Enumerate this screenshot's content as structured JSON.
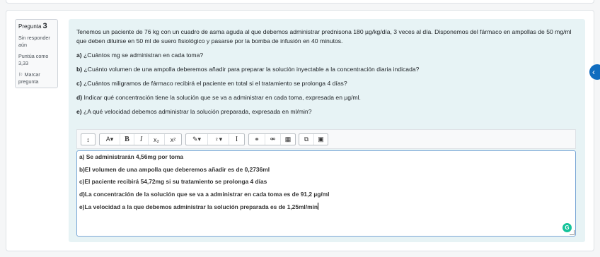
{
  "question": {
    "label": "Pregunta",
    "number": "3",
    "status": "Sin responder aún",
    "score": "Puntúa como 3,33",
    "flag_label": "Marcar pregunta",
    "intro": "Tenemos un paciente de 76 kg con un cuadro de asma aguda al que debemos administrar prednisona 180 µg/kg/día, 3 veces al día. Disponemos del fármaco en ampollas de 50 mg/ml que deben diluirse en 50 ml de suero fisiológico y pasarse por la bomba de infusión en 40 minutos.",
    "items": [
      {
        "letter": "a)",
        "text": " ¿Cuántos mg se administran en cada toma?"
      },
      {
        "letter": "b)",
        "text": " ¿Cuánto volumen de una ampolla deberemos añadir para preparar la solución inyectable a la concentración diaria indicada?"
      },
      {
        "letter": "c)",
        "text": " ¿Cuántos miligramos de fármaco recibirá el paciente en total si el tratamiento se prolonga 4 días?"
      },
      {
        "letter": "d)",
        "text": " Indicar qué concentración tiene la solución que se va a administrar en cada toma, expresada en µg/ml."
      },
      {
        "letter": "e)",
        "text": " ¿A qué velocidad debemos administrar la solución preparada, expresada en ml/min?"
      }
    ]
  },
  "toolbar": {
    "collapse": "↕",
    "font": "A▾",
    "bold": "B",
    "italic": "I",
    "subscript": "x₂",
    "superscript": "x²",
    "brush": "✎▾",
    "bulb": "♀▾",
    "cursor": "I",
    "link": "⚭",
    "unlink": "⚮",
    "media": "▦",
    "copy": "⧉",
    "image": "▣"
  },
  "answer": {
    "lines": [
      "a) Se administrarán 4,56mg por toma",
      "b)El volumen de una ampolla que deberemos añadir es de 0,2736ml",
      "c)El paciente recibirá 54,72mg si su tratamiento se prolonga 4 días",
      "d)La concentración de la solución que se va a administrar en cada toma es de 91,2 µg/ml",
      "e)La velocidad a la que debemos administrar la solución preparada es de 1,25ml/min"
    ]
  },
  "grammarly_icon": "G",
  "nav_icon": "‹",
  "colors": {
    "accent": "#0f6cbf",
    "content_bg": "#e7f3f5",
    "grammarly": "#15c39a"
  }
}
